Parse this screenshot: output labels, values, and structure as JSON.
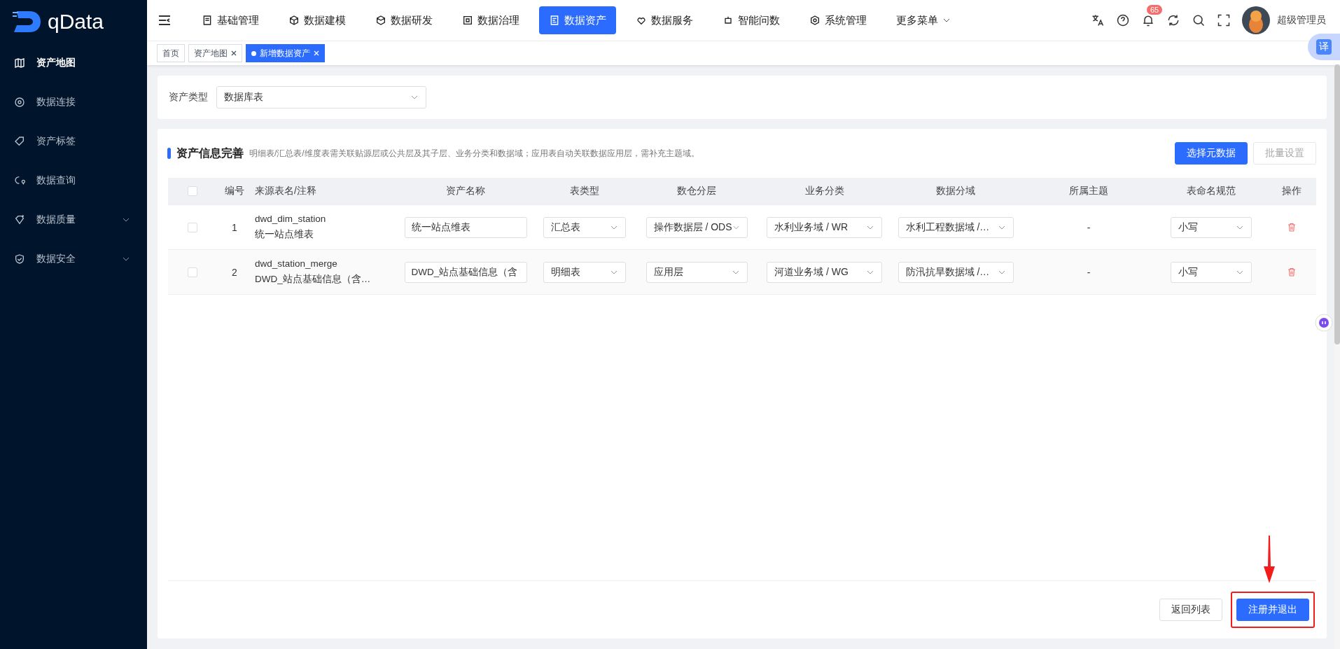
{
  "logo": {
    "text": "qData"
  },
  "sidebar": {
    "items": [
      {
        "label": "资产地图",
        "selected": true,
        "kind": "link"
      },
      {
        "label": "数据连接",
        "selected": false,
        "kind": "link"
      },
      {
        "label": "资产标签",
        "selected": false,
        "kind": "link"
      },
      {
        "label": "数据查询",
        "selected": false,
        "kind": "link"
      },
      {
        "label": "数据质量",
        "selected": false,
        "kind": "group"
      },
      {
        "label": "数据安全",
        "selected": false,
        "kind": "group"
      }
    ]
  },
  "top_nav": {
    "items": [
      {
        "label": "基础管理",
        "selected": false
      },
      {
        "label": "数据建模",
        "selected": false
      },
      {
        "label": "数据研发",
        "selected": false
      },
      {
        "label": "数据治理",
        "selected": false
      },
      {
        "label": "数据资产",
        "selected": true
      },
      {
        "label": "数据服务",
        "selected": false
      },
      {
        "label": "智能问数",
        "selected": false
      },
      {
        "label": "系统管理",
        "selected": false
      }
    ],
    "more": "更多菜单",
    "notification_count": "65",
    "user": "超级管理员",
    "translate": "译"
  },
  "page_tabs": [
    {
      "label": "首页",
      "selected": false,
      "closable": false
    },
    {
      "label": "资产地图",
      "selected": false,
      "closable": true
    },
    {
      "label": "新增数据资产",
      "selected": true,
      "closable": true
    }
  ],
  "filter": {
    "label": "资产类型",
    "value": "数据库表"
  },
  "section": {
    "title": "资产信息完善",
    "hint": "明细表/汇总表/维度表需关联贴源层或公共层及其子层、业务分类和数据域；应用表自动关联数据应用层，需补充主题域。",
    "primary_button": "选择元数据",
    "secondary_button": "批量设置",
    "secondary_disabled": true
  },
  "table": {
    "columns": [
      "编号",
      "来源表名/注释",
      "资产名称",
      "表类型",
      "数仓分层",
      "业务分类",
      "数据分域",
      "所属主题",
      "表命名规范",
      "操作"
    ],
    "all_checked": false,
    "rows": [
      {
        "checked": false,
        "index": "1",
        "source_name": "dwd_dim_station",
        "source_comment": "统一站点维表",
        "asset_name": "统一站点维表",
        "table_type": "汇总表",
        "layer": "操作数据层 / ODS",
        "business": "水利业务域 / WR",
        "domain": "水利工程数据域 /…",
        "theme": "-",
        "naming": "小写"
      },
      {
        "checked": false,
        "index": "2",
        "source_name": "dwd_station_merge",
        "source_comment": "DWD_站点基础信息（含…",
        "asset_name": "DWD_站点基础信息（含",
        "table_type": "明细表",
        "layer": "应用层",
        "business": "河道业务域 / WG",
        "domain": "防汛抗旱数据域 /…",
        "theme": "-",
        "naming": "小写"
      }
    ]
  },
  "footer": {
    "back_button": "返回列表",
    "submit_button": "注册并退出"
  }
}
